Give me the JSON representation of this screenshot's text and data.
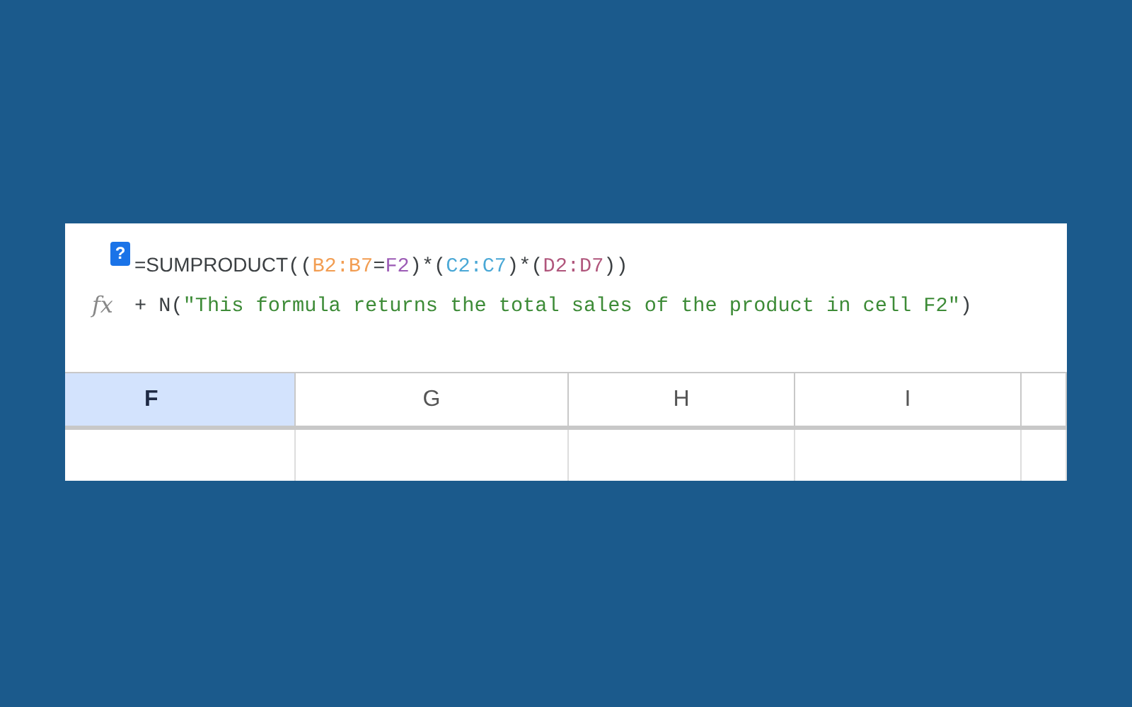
{
  "formula_bar": {
    "help": "?",
    "fx": "fx",
    "lines": [
      [
        {
          "text": "=SUMPRODUCT",
          "kind": "name",
          "color": "#3c4043"
        },
        {
          "text": "((",
          "kind": "code",
          "color": "#3c4043"
        },
        {
          "text": "B2:B7",
          "kind": "code",
          "color": "#f29d52"
        },
        {
          "text": "=",
          "kind": "code",
          "color": "#3c4043"
        },
        {
          "text": "F2",
          "kind": "code",
          "color": "#9c5bb5"
        },
        {
          "text": ")*(",
          "kind": "code",
          "color": "#3c4043"
        },
        {
          "text": "C2:C7",
          "kind": "code",
          "color": "#4aa8d6"
        },
        {
          "text": ")*(",
          "kind": "code",
          "color": "#3c4043"
        },
        {
          "text": "D2:D7",
          "kind": "code",
          "color": "#b0567c"
        },
        {
          "text": "))",
          "kind": "code",
          "color": "#3c4043"
        }
      ],
      [
        {
          "text": "+ N(",
          "kind": "code",
          "color": "#3c4043"
        },
        {
          "text": "\"This formula returns the total sales of the product in cell F2\"",
          "kind": "code",
          "color": "#3d8b37"
        },
        {
          "text": ")",
          "kind": "code",
          "color": "#3c4043"
        }
      ]
    ]
  },
  "columns": [
    {
      "label": "F",
      "selected": true
    },
    {
      "label": "G",
      "selected": false
    },
    {
      "label": "H",
      "selected": false
    },
    {
      "label": "I",
      "selected": false
    }
  ]
}
